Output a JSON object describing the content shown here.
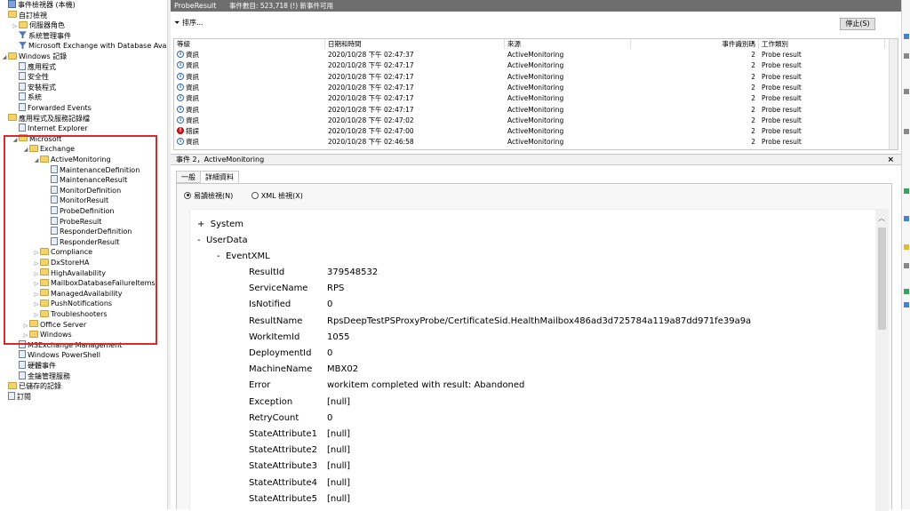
{
  "tree": {
    "items": [
      {
        "label": "事件檢視器 (本機)",
        "indent": 0,
        "icon": "viewer-icon",
        "exp": ""
      },
      {
        "label": "自訂檢視",
        "indent": 0,
        "icon": "folder-icon",
        "exp": ""
      },
      {
        "label": "伺服器角色",
        "indent": 1,
        "icon": "folder-icon",
        "exp": "▷"
      },
      {
        "label": "系統管理事件",
        "indent": 1,
        "icon": "filter-icon",
        "exp": ""
      },
      {
        "label": "Microsoft Exchange with Database Availabili",
        "indent": 1,
        "icon": "filter-icon",
        "exp": ""
      },
      {
        "label": "Windows 記錄",
        "indent": 0,
        "icon": "folder-icon",
        "exp": "◢"
      },
      {
        "label": "應用程式",
        "indent": 1,
        "icon": "log-icon",
        "exp": ""
      },
      {
        "label": "安全性",
        "indent": 1,
        "icon": "log-icon",
        "exp": ""
      },
      {
        "label": "安裝程式",
        "indent": 1,
        "icon": "log-icon",
        "exp": ""
      },
      {
        "label": "系統",
        "indent": 1,
        "icon": "log-icon",
        "exp": ""
      },
      {
        "label": "Forwarded Events",
        "indent": 1,
        "icon": "log-icon",
        "exp": ""
      },
      {
        "label": "應用程式及服務記錄檔",
        "indent": 0,
        "icon": "folder-icon",
        "exp": ""
      },
      {
        "label": "Internet Explorer",
        "indent": 1,
        "icon": "log-icon",
        "exp": ""
      },
      {
        "label": "Microsoft",
        "indent": 1,
        "icon": "folder-icon",
        "exp": "◢"
      },
      {
        "label": "Exchange",
        "indent": 2,
        "icon": "folder-icon",
        "exp": "◢"
      },
      {
        "label": "ActiveMonitoring",
        "indent": 3,
        "icon": "folder-icon",
        "exp": "◢"
      },
      {
        "label": "MaintenanceDefinition",
        "indent": 4,
        "icon": "log-icon",
        "exp": ""
      },
      {
        "label": "MaintenanceResult",
        "indent": 4,
        "icon": "log-icon",
        "exp": ""
      },
      {
        "label": "MonitorDefinition",
        "indent": 4,
        "icon": "log-icon",
        "exp": ""
      },
      {
        "label": "MonitorResult",
        "indent": 4,
        "icon": "log-icon",
        "exp": ""
      },
      {
        "label": "ProbeDefinition",
        "indent": 4,
        "icon": "log-icon",
        "exp": ""
      },
      {
        "label": "ProbeResult",
        "indent": 4,
        "icon": "log-icon",
        "exp": ""
      },
      {
        "label": "ResponderDefinition",
        "indent": 4,
        "icon": "log-icon",
        "exp": ""
      },
      {
        "label": "ResponderResult",
        "indent": 4,
        "icon": "log-icon",
        "exp": ""
      },
      {
        "label": "Compliance",
        "indent": 3,
        "icon": "folder-icon",
        "exp": "▷"
      },
      {
        "label": "DxStoreHA",
        "indent": 3,
        "icon": "folder-icon",
        "exp": "▷"
      },
      {
        "label": "HighAvailability",
        "indent": 3,
        "icon": "folder-icon",
        "exp": "▷"
      },
      {
        "label": "MailboxDatabaseFailureItems",
        "indent": 3,
        "icon": "folder-icon",
        "exp": "▷"
      },
      {
        "label": "ManagedAvailability",
        "indent": 3,
        "icon": "folder-icon",
        "exp": "▷"
      },
      {
        "label": "PushNotifications",
        "indent": 3,
        "icon": "folder-icon",
        "exp": "▷"
      },
      {
        "label": "Troubleshooters",
        "indent": 3,
        "icon": "folder-icon",
        "exp": "▷"
      },
      {
        "label": "Office Server",
        "indent": 2,
        "icon": "folder-icon",
        "exp": "▷"
      },
      {
        "label": "Windows",
        "indent": 2,
        "icon": "folder-icon",
        "exp": "▷"
      },
      {
        "label": "MSExchange Management",
        "indent": 1,
        "icon": "log-icon",
        "exp": ""
      },
      {
        "label": "Windows PowerShell",
        "indent": 1,
        "icon": "log-icon",
        "exp": ""
      },
      {
        "label": "硬體事件",
        "indent": 1,
        "icon": "log-icon",
        "exp": ""
      },
      {
        "label": "金鑰管理服務",
        "indent": 1,
        "icon": "log-icon",
        "exp": ""
      },
      {
        "label": "已儲存的記錄",
        "indent": 0,
        "icon": "folder-icon",
        "exp": ""
      },
      {
        "label": "訂閱",
        "indent": 0,
        "icon": "log-icon",
        "exp": ""
      }
    ]
  },
  "title": {
    "name": "ProbeResult",
    "count": "事件數目: 523,718 (!) 新事件可用"
  },
  "toolbar": {
    "sort_label": "排序...",
    "stop_label": "停止(S)"
  },
  "grid": {
    "columns": [
      "等級",
      "日期和時間",
      "來源",
      "事件識別碼",
      "工作類別"
    ],
    "rows": [
      {
        "level": "資訊",
        "type": "info",
        "datetime": "2020/10/28 下午 02:47:37",
        "source": "ActiveMonitoring",
        "id": "2",
        "category": "Probe result"
      },
      {
        "level": "資訊",
        "type": "info",
        "datetime": "2020/10/28 下午 02:47:17",
        "source": "ActiveMonitoring",
        "id": "2",
        "category": "Probe result"
      },
      {
        "level": "資訊",
        "type": "info",
        "datetime": "2020/10/28 下午 02:47:17",
        "source": "ActiveMonitoring",
        "id": "2",
        "category": "Probe result"
      },
      {
        "level": "資訊",
        "type": "info",
        "datetime": "2020/10/28 下午 02:47:17",
        "source": "ActiveMonitoring",
        "id": "2",
        "category": "Probe result"
      },
      {
        "level": "資訊",
        "type": "info",
        "datetime": "2020/10/28 下午 02:47:17",
        "source": "ActiveMonitoring",
        "id": "2",
        "category": "Probe result"
      },
      {
        "level": "資訊",
        "type": "info",
        "datetime": "2020/10/28 下午 02:47:17",
        "source": "ActiveMonitoring",
        "id": "2",
        "category": "Probe result"
      },
      {
        "level": "資訊",
        "type": "info",
        "datetime": "2020/10/28 下午 02:47:02",
        "source": "ActiveMonitoring",
        "id": "2",
        "category": "Probe result"
      },
      {
        "level": "錯誤",
        "type": "error",
        "datetime": "2020/10/28 下午 02:47:00",
        "source": "ActiveMonitoring",
        "id": "2",
        "category": "Probe result"
      },
      {
        "level": "資訊",
        "type": "info",
        "datetime": "2020/10/28 下午 02:46:58",
        "source": "ActiveMonitoring",
        "id": "2",
        "category": "Probe result"
      }
    ]
  },
  "detail": {
    "header": "事件 2，ActiveMonitoring",
    "close": "×",
    "tabs": [
      "一般",
      "詳細資料"
    ],
    "view_friendly": "易讀檢視(N)",
    "view_xml": "XML 檢視(X)",
    "system_label": "System",
    "userdata_label": "UserData",
    "eventxml_label": "EventXML",
    "plus": "+",
    "minus": "-",
    "fields": [
      {
        "key": "ResultId",
        "value": "379548532"
      },
      {
        "key": "ServiceName",
        "value": "RPS"
      },
      {
        "key": "IsNotified",
        "value": "0"
      },
      {
        "key": "ResultName",
        "value": "RpsDeepTestPSProxyProbe/CertificateSid.HealthMailbox486ad3d725784a119a87dd971fe39a9a"
      },
      {
        "key": "WorkItemId",
        "value": "1055"
      },
      {
        "key": "DeploymentId",
        "value": "0"
      },
      {
        "key": "MachineName",
        "value": "MBX02"
      },
      {
        "key": "Error",
        "value": "workitem completed with result: Abandoned"
      },
      {
        "key": "Exception",
        "value": "[null]"
      },
      {
        "key": "RetryCount",
        "value": "0"
      },
      {
        "key": "StateAttribute1",
        "value": "[null]"
      },
      {
        "key": "StateAttribute2",
        "value": "[null]"
      },
      {
        "key": "StateAttribute3",
        "value": "[null]"
      },
      {
        "key": "StateAttribute4",
        "value": "[null]"
      },
      {
        "key": "StateAttribute5",
        "value": "[null]"
      }
    ]
  },
  "colors": {
    "highlight_border": "#d92b2b",
    "title_bar": "#6e6e6e",
    "error_icon": "#d01f1f",
    "info_icon": "#2f66b8"
  }
}
